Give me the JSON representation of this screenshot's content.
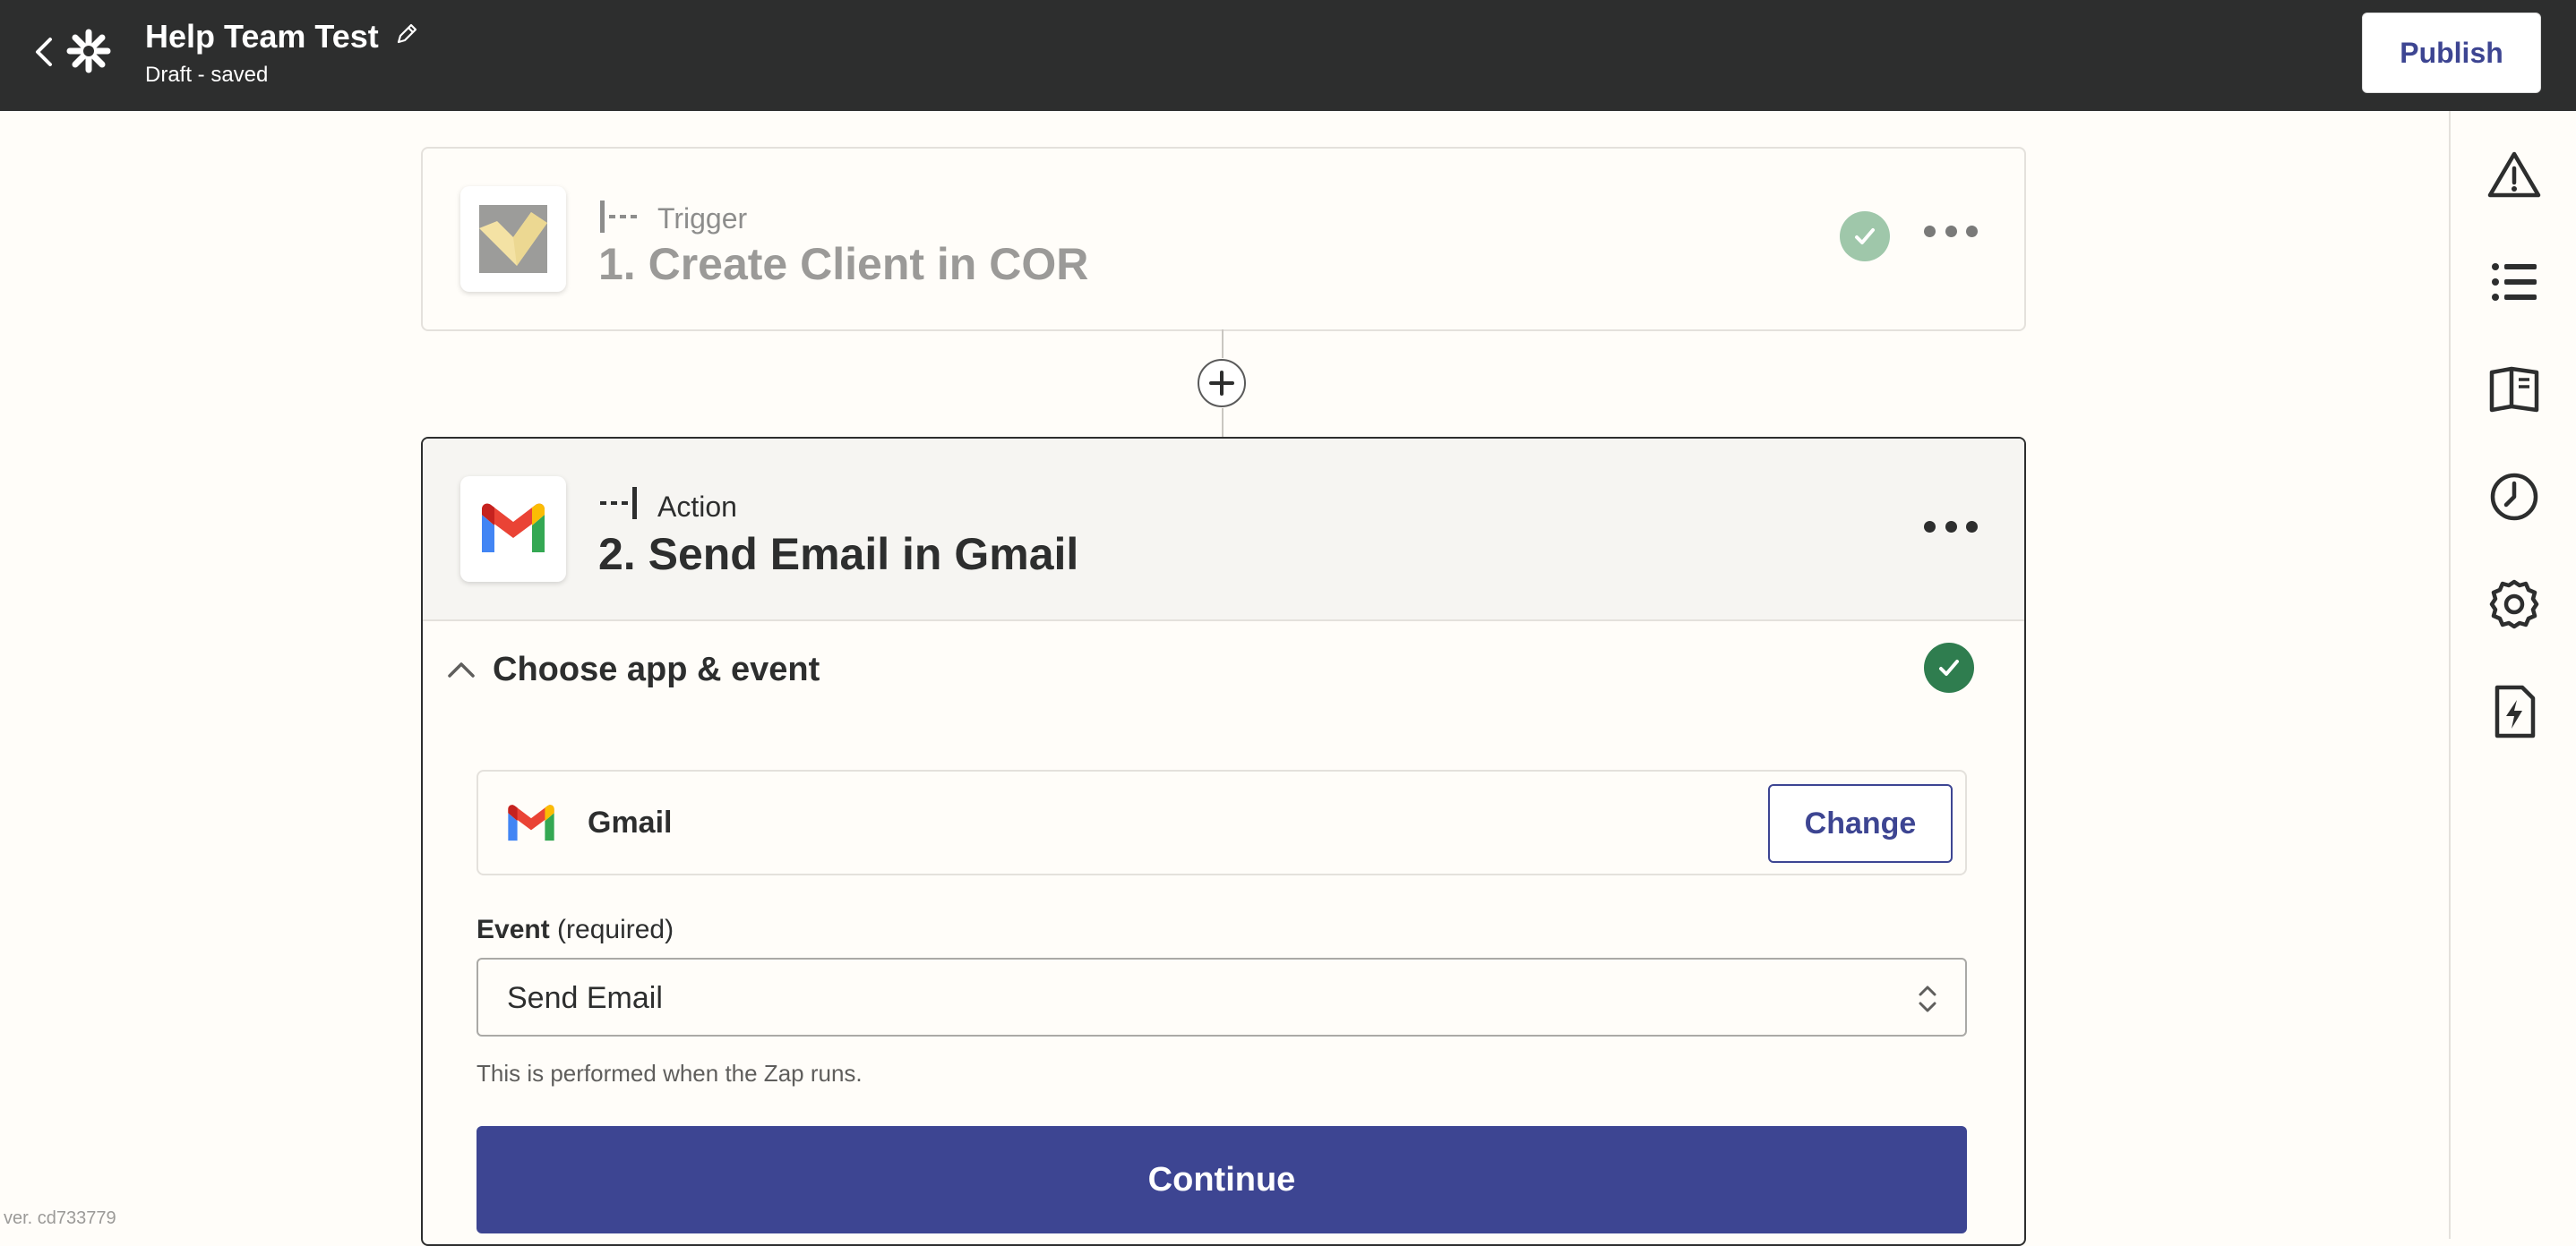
{
  "header": {
    "title": "Help Team Test",
    "status": "Draft - saved",
    "publish_label": "Publish"
  },
  "trigger": {
    "type_label": "Trigger",
    "title": "1. Create Client in COR",
    "icon": "cor-app-icon"
  },
  "action": {
    "type_label": "Action",
    "title": "2. Send Email in Gmail",
    "icon": "gmail-icon",
    "section": {
      "title": "Choose app & event",
      "app_name": "Gmail",
      "change_label": "Change",
      "event_label": "Event",
      "event_required": "(required)",
      "event_value": "Send Email",
      "helper_text": "This is performed when the Zap runs.",
      "continue_label": "Continue"
    }
  },
  "sidebar": {
    "items": [
      "warning-icon",
      "list-icon",
      "book-icon",
      "history-icon",
      "settings-icon",
      "zap-file-icon"
    ]
  },
  "version": "ver. cd733779",
  "colors": {
    "topbar": "#2d2e2e",
    "accent": "#3d4592",
    "success": "#2f7d4f",
    "success_faded": "#9fc7aa"
  }
}
